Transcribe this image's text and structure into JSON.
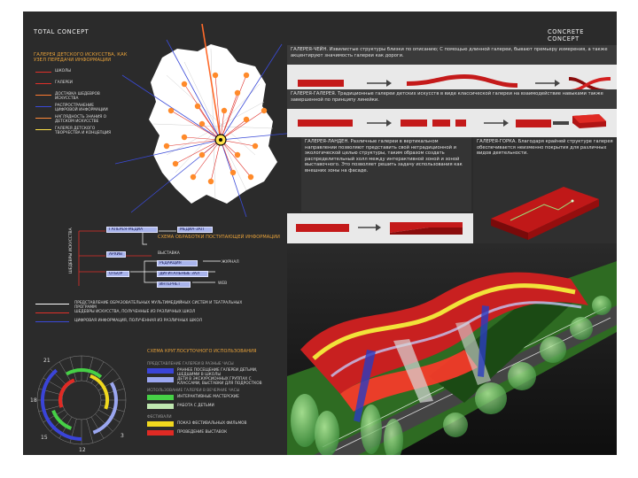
{
  "headers": {
    "left": "TOTAL CONCEPT",
    "right": "CONCRETE CONCEPT"
  },
  "map_legend": {
    "title": "ГАЛЕРЕЯ ДЕТСКОГО ИСКУССТВА, КАК УЗЕЛ ПЕРЕДАЧИ ИНФОРМАЦИИ",
    "items": [
      {
        "text": "ШКОЛЫ",
        "color": "#e0302a"
      },
      {
        "text": "ГАЛЕРЕИ",
        "color": "#e0302a"
      },
      {
        "text": "ДОСТАВКА ШЕДЕВРОВ ИСКУССТВА",
        "color": "#ff7a30"
      },
      {
        "text": "РАСПРОСТРАНЕНИЕ ЦИФРОВОЙ ИНФОРМАЦИИ",
        "color": "#3a4ad8"
      },
      {
        "text": "НАГЛЯДНОСТЬ ЗНАНИЯ О ДЕТСКОМ ИСКУССТВЕ",
        "color": "#ff8a3a"
      },
      {
        "text": "ГАЛЕРЕЯ ДЕТСКОГО ТВОРЧЕСТВА И КОНЦЕПЦИЯ",
        "color": "#ffe24a"
      }
    ]
  },
  "flow": {
    "title": "СХЕМА ОБРАБОТКИ ПОСТУПАЮЩЕЙ ИНФОРМАЦИИ",
    "side_label": "ШЕДЕВРЫ ИСКУССТВА",
    "boxes": [
      "ГАЛЕРЕЯ-МЕДИА",
      "МЕДИА-ЗАЛ",
      "АРХИВ",
      "ВЫСТАВКА",
      "ОТБОР",
      "РЕДАКЦИЯ",
      "ЖУРНАЛ",
      "ДИГИТАЛЬНЫЕ ЗАЛ",
      "ИНТЕРНЕТ",
      "WEB"
    ],
    "legend": [
      {
        "text": "ПРЕДСТАВЛЕНИЕ ОБРАЗОВАТЕЛЬНЫХ МУЛЬТИМЕДИЙНЫХ СИСТЕМ И ТЕАТРАЛЬНЫХ ПРОГРАММ",
        "color": "#ffffff"
      },
      {
        "text": "ШЕДЕВРЫ ИСКУССТВА, ПОЛУЧЕННЫЕ ИЗ РАЗЛИЧНЫХ ШКОЛ",
        "color": "#e0302a"
      },
      {
        "text": "ЦИФРОВАЯ ИНФОРМАЦИЯ, ПОЛУЧЕННАЯ ИЗ РАЗЛИЧНЫХ ШКОЛ",
        "color": "#3a4ad8"
      }
    ]
  },
  "clock": {
    "numbers": [
      "21",
      "18",
      "15",
      "12",
      "3"
    ],
    "rings": [
      {
        "name": "blue",
        "color": "#3a44d8",
        "arcs": [
          [
            180,
            320
          ]
        ]
      },
      {
        "name": "light-blue",
        "color": "#9aa6f0",
        "arcs": [
          [
            60,
            160
          ]
        ]
      },
      {
        "name": "green",
        "color": "#46d046",
        "arcs": [
          [
            330,
            360
          ],
          [
            0,
            40
          ],
          [
            200,
            250
          ]
        ]
      },
      {
        "name": "yellow",
        "color": "#f0d81e",
        "arcs": [
          [
            20,
            110
          ]
        ]
      },
      {
        "name": "red",
        "color": "#e02a24",
        "arcs": [
          [
            250,
            340
          ]
        ]
      }
    ]
  },
  "usage": {
    "title": "СХЕМА КРУГЛОСУТОЧНОГО ИСПОЛЬЗОВАНИЯ",
    "groups": [
      {
        "header": "ПРЕДСТАВЛЕНИЕ ГАЛЕРЕИ В РАЗНЫЕ ЧАСЫ",
        "rows": [
          {
            "color": "#3a44d8",
            "text": "РАННЕЕ ПОСЕЩЕНИЕ ГАЛЕРЕИ ДЕТЬМИ, ШЕДШИМИ В ШКОЛЫ"
          },
          {
            "color": "#9aa6f0",
            "text": "ДЕТИ В ЭКСКУРСИОННЫХ ГРУППАХ С КЛАССАМИ, ВЫСТАВКИ ДЛЯ ПОДРОСТКОВ"
          }
        ]
      },
      {
        "header": "ИСПОЛЬЗОВАНИЕ ГАЛЕРЕИ В ВЕЧЕРНИЕ ЧАСЫ",
        "rows": [
          {
            "color": "#46d046",
            "text": "ИНТЕРАКТИВНЫЕ МАСТЕРСКИЕ"
          },
          {
            "color": "#bfe7b0",
            "text": "РАБОТА С ДЕТЬМИ"
          }
        ]
      },
      {
        "header": "ФЕСТИВАЛИ",
        "rows": [
          {
            "color": "#f0d81e",
            "text": "ПОКАЗ ФЕСТИВАЛЬНЫХ ФИЛЬМОВ"
          },
          {
            "color": "#e02a24",
            "text": "ПРОВЕДЕНИЕ ВЫСТАВОК"
          }
        ]
      }
    ]
  },
  "concepts": [
    {
      "title": "ГАЛЕРЕЯ-ЧЕЙН.",
      "text": "Извилистые структуры близки по описанию; С помощью длинной галереи, бывают премьеру измерения, а также акцентируют значимость галереи как дороги."
    },
    {
      "title": "ГАЛЕРЕЯ-ГАЛЕРЕЯ.",
      "text": "Традиционные галереи детских искусств в виде классической галереи на взаимодействие навыками также завершенной по принципу линейки."
    },
    {
      "title": "ГАЛЕРЕЯ-ЛАНДЕН.",
      "text": "Различные галереи в вертикальном направлении позволяют представить свой нетрадиционной и экологической целью структуры, таким образом создать распределительный холл между интерактивной зоной и зоной выставочного. Это позволяет решить задачу использования как внешних зоны на фасаде."
    },
    {
      "title": "ГАЛЕРЕЯ-ГОРКА.",
      "text": "Благодаря крайней структуре галерея обеспечивается неизменно покрытия для различных видов деятельности."
    }
  ]
}
